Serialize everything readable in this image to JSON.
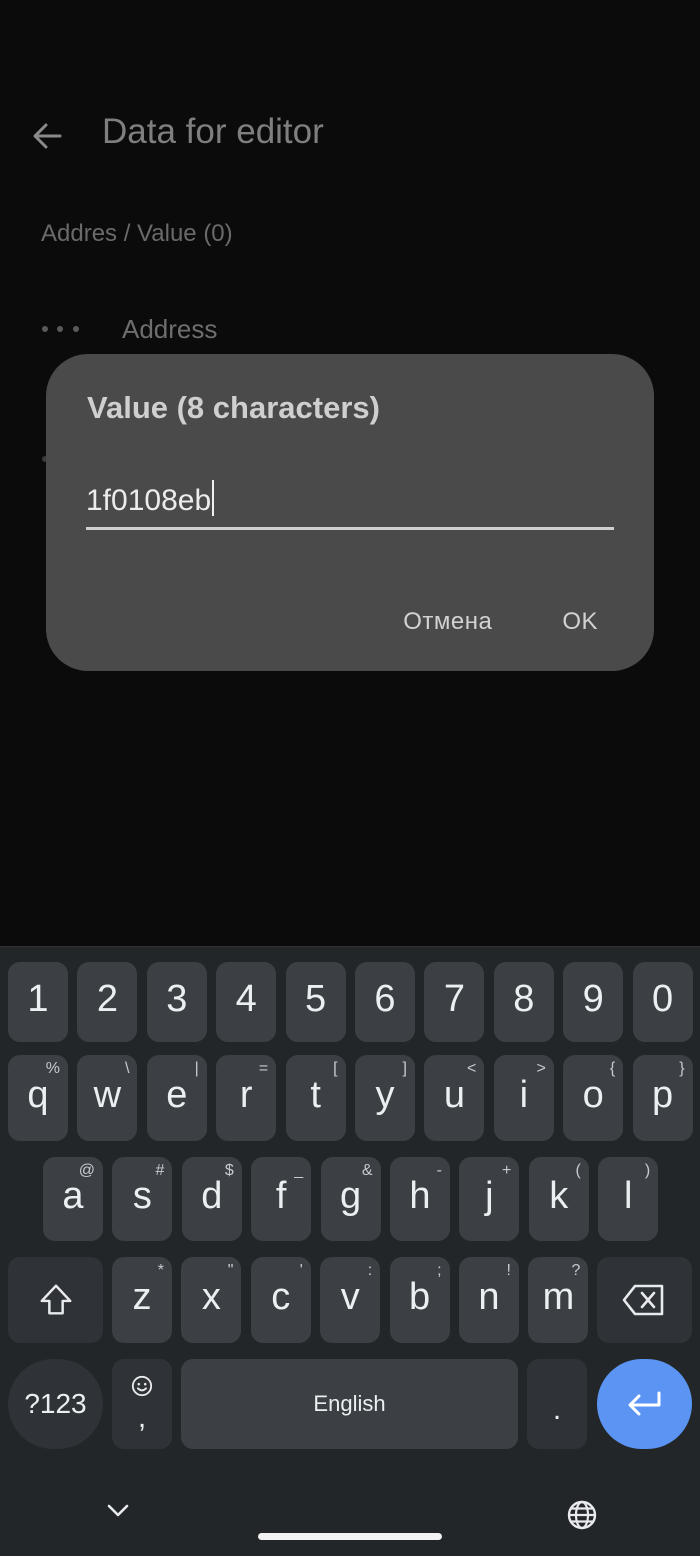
{
  "app": {
    "title": "Data for editor",
    "section_label": "Addres / Value (0)",
    "row_label": "Address",
    "icons": [
      "arrow-left-icon",
      "more-horiz-icon"
    ]
  },
  "dialog": {
    "title": "Value (8 characters)",
    "input_value": "1f0108eb",
    "cancel_label": "Отмена",
    "ok_label": "OK"
  },
  "keyboard": {
    "number_row": [
      "1",
      "2",
      "3",
      "4",
      "5",
      "6",
      "7",
      "8",
      "9",
      "0"
    ],
    "row1": [
      [
        "q",
        "%"
      ],
      [
        "w",
        "\\"
      ],
      [
        "e",
        "|"
      ],
      [
        "r",
        "="
      ],
      [
        "t",
        "["
      ],
      [
        "y",
        "]"
      ],
      [
        "u",
        "<"
      ],
      [
        "i",
        ">"
      ],
      [
        "o",
        "{"
      ],
      [
        "p",
        "}"
      ]
    ],
    "row2": [
      [
        "a",
        "@"
      ],
      [
        "s",
        "#"
      ],
      [
        "d",
        "$"
      ],
      [
        "f",
        "_"
      ],
      [
        "g",
        "&"
      ],
      [
        "h",
        "-"
      ],
      [
        "j",
        "+"
      ],
      [
        "k",
        "("
      ],
      [
        "l",
        ")"
      ]
    ],
    "row3": [
      [
        "z",
        "*"
      ],
      [
        "x",
        "\""
      ],
      [
        "c",
        "'"
      ],
      [
        "v",
        ":"
      ],
      [
        "b",
        ";"
      ],
      [
        "n",
        "!"
      ],
      [
        "m",
        "?"
      ]
    ],
    "symbols_label": "?123",
    "comma_label": ",",
    "space_label": "English",
    "period_label": ".",
    "icons": [
      "shift-icon",
      "backspace-icon",
      "emoji-icon",
      "enter-icon",
      "chevron-down-icon",
      "globe-icon"
    ]
  }
}
